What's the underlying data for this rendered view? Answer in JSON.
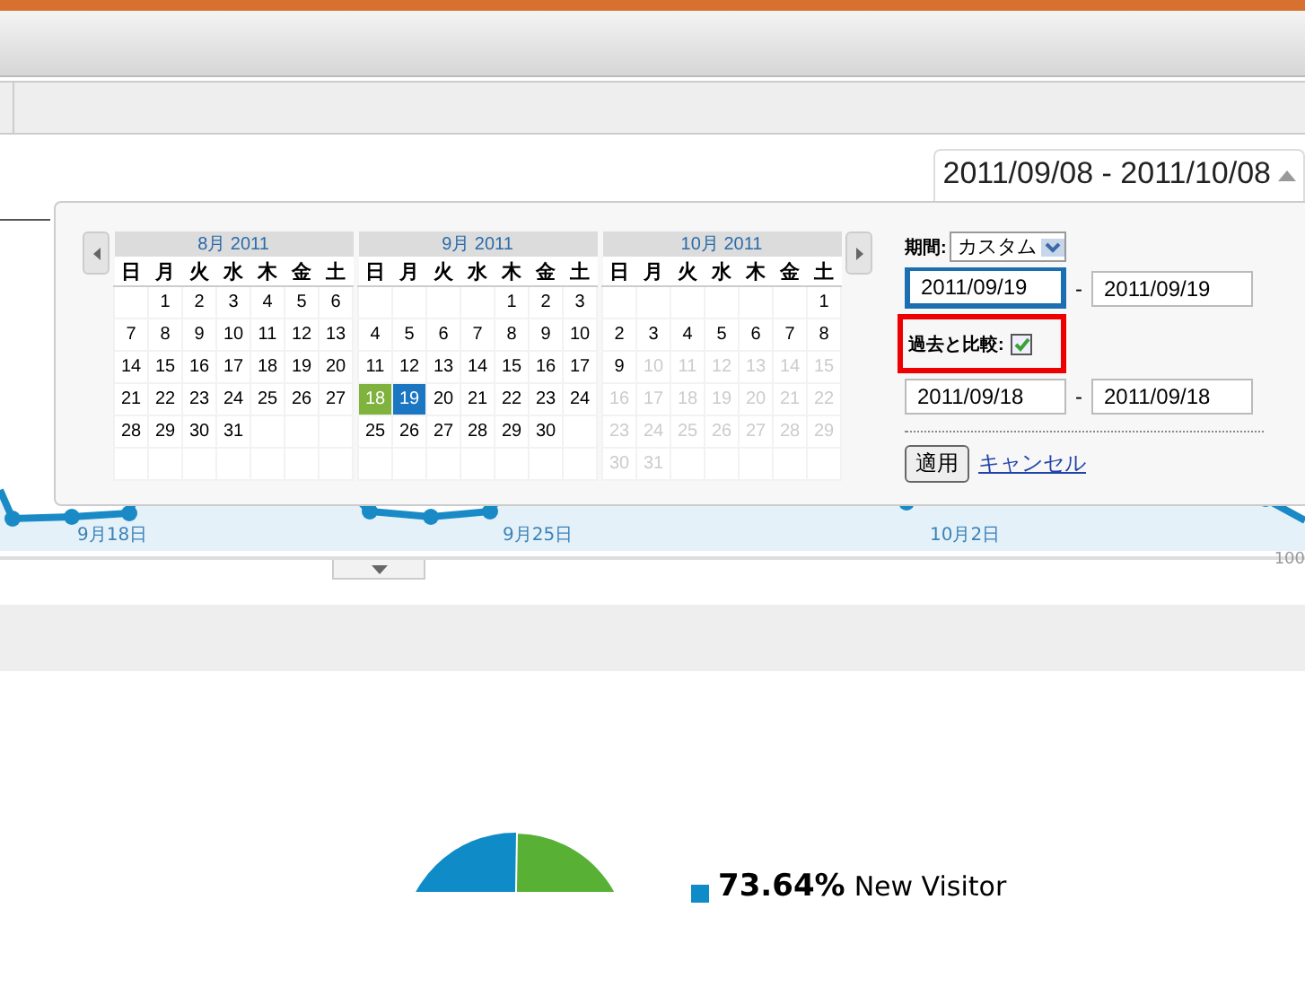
{
  "date_range": {
    "text": "2011/09/08 - 2011/10/08"
  },
  "chart": {
    "x_labels": [
      "9月18日",
      "9月25日",
      "10月2日"
    ],
    "y_label": "100"
  },
  "picker": {
    "months": [
      {
        "title": "8月 2011",
        "weekdays": [
          "日",
          "月",
          "火",
          "水",
          "木",
          "金",
          "土"
        ],
        "weeks": [
          [
            {
              "kind": "blank"
            },
            {
              "d": "1",
              "kind": "day"
            },
            {
              "d": "2",
              "kind": "day"
            },
            {
              "d": "3",
              "kind": "day"
            },
            {
              "d": "4",
              "kind": "day"
            },
            {
              "d": "5",
              "kind": "day"
            },
            {
              "d": "6",
              "kind": "day"
            }
          ],
          [
            {
              "d": "7",
              "kind": "day"
            },
            {
              "d": "8",
              "kind": "day"
            },
            {
              "d": "9",
              "kind": "day"
            },
            {
              "d": "10",
              "kind": "day"
            },
            {
              "d": "11",
              "kind": "day"
            },
            {
              "d": "12",
              "kind": "day"
            },
            {
              "d": "13",
              "kind": "day"
            }
          ],
          [
            {
              "d": "14",
              "kind": "day"
            },
            {
              "d": "15",
              "kind": "day"
            },
            {
              "d": "16",
              "kind": "day"
            },
            {
              "d": "17",
              "kind": "day"
            },
            {
              "d": "18",
              "kind": "day"
            },
            {
              "d": "19",
              "kind": "day"
            },
            {
              "d": "20",
              "kind": "day"
            }
          ],
          [
            {
              "d": "21",
              "kind": "day"
            },
            {
              "d": "22",
              "kind": "day"
            },
            {
              "d": "23",
              "kind": "day"
            },
            {
              "d": "24",
              "kind": "day"
            },
            {
              "d": "25",
              "kind": "day"
            },
            {
              "d": "26",
              "kind": "day"
            },
            {
              "d": "27",
              "kind": "day"
            }
          ],
          [
            {
              "d": "28",
              "kind": "day"
            },
            {
              "d": "29",
              "kind": "day"
            },
            {
              "d": "30",
              "kind": "day"
            },
            {
              "d": "31",
              "kind": "day"
            },
            {
              "kind": "blank"
            },
            {
              "kind": "blank"
            },
            {
              "kind": "blank"
            }
          ]
        ]
      },
      {
        "title": "9月 2011",
        "weekdays": [
          "日",
          "月",
          "火",
          "水",
          "木",
          "金",
          "土"
        ],
        "weeks": [
          [
            {
              "kind": "blank"
            },
            {
              "kind": "blank"
            },
            {
              "kind": "blank"
            },
            {
              "kind": "blank"
            },
            {
              "d": "1",
              "kind": "day"
            },
            {
              "d": "2",
              "kind": "day"
            },
            {
              "d": "3",
              "kind": "day"
            }
          ],
          [
            {
              "d": "4",
              "kind": "day"
            },
            {
              "d": "5",
              "kind": "day"
            },
            {
              "d": "6",
              "kind": "day"
            },
            {
              "d": "7",
              "kind": "day"
            },
            {
              "d": "8",
              "kind": "day"
            },
            {
              "d": "9",
              "kind": "day"
            },
            {
              "d": "10",
              "kind": "day"
            }
          ],
          [
            {
              "d": "11",
              "kind": "day"
            },
            {
              "d": "12",
              "kind": "day"
            },
            {
              "d": "13",
              "kind": "day"
            },
            {
              "d": "14",
              "kind": "day"
            },
            {
              "d": "15",
              "kind": "day"
            },
            {
              "d": "16",
              "kind": "day"
            },
            {
              "d": "17",
              "kind": "day"
            }
          ],
          [
            {
              "d": "18",
              "kind": "compare"
            },
            {
              "d": "19",
              "kind": "range"
            },
            {
              "d": "20",
              "kind": "day"
            },
            {
              "d": "21",
              "kind": "day"
            },
            {
              "d": "22",
              "kind": "day"
            },
            {
              "d": "23",
              "kind": "day"
            },
            {
              "d": "24",
              "kind": "day"
            }
          ],
          [
            {
              "d": "25",
              "kind": "day"
            },
            {
              "d": "26",
              "kind": "day"
            },
            {
              "d": "27",
              "kind": "day"
            },
            {
              "d": "28",
              "kind": "day"
            },
            {
              "d": "29",
              "kind": "day"
            },
            {
              "d": "30",
              "kind": "day"
            },
            {
              "kind": "blank"
            }
          ]
        ]
      },
      {
        "title": "10月 2011",
        "weekdays": [
          "日",
          "月",
          "火",
          "水",
          "木",
          "金",
          "土"
        ],
        "weeks": [
          [
            {
              "kind": "blank"
            },
            {
              "kind": "blank"
            },
            {
              "kind": "blank"
            },
            {
              "kind": "blank"
            },
            {
              "kind": "blank"
            },
            {
              "kind": "blank"
            },
            {
              "d": "1",
              "kind": "day"
            }
          ],
          [
            {
              "d": "2",
              "kind": "day"
            },
            {
              "d": "3",
              "kind": "day"
            },
            {
              "d": "4",
              "kind": "day"
            },
            {
              "d": "5",
              "kind": "day"
            },
            {
              "d": "6",
              "kind": "day"
            },
            {
              "d": "7",
              "kind": "day"
            },
            {
              "d": "8",
              "kind": "day"
            }
          ],
          [
            {
              "d": "9",
              "kind": "day"
            },
            {
              "d": "10",
              "kind": "future"
            },
            {
              "d": "11",
              "kind": "future"
            },
            {
              "d": "12",
              "kind": "future"
            },
            {
              "d": "13",
              "kind": "future"
            },
            {
              "d": "14",
              "kind": "future"
            },
            {
              "d": "15",
              "kind": "future"
            }
          ],
          [
            {
              "d": "16",
              "kind": "future"
            },
            {
              "d": "17",
              "kind": "future"
            },
            {
              "d": "18",
              "kind": "future"
            },
            {
              "d": "19",
              "kind": "future"
            },
            {
              "d": "20",
              "kind": "future"
            },
            {
              "d": "21",
              "kind": "future"
            },
            {
              "d": "22",
              "kind": "future"
            }
          ],
          [
            {
              "d": "23",
              "kind": "future"
            },
            {
              "d": "24",
              "kind": "future"
            },
            {
              "d": "25",
              "kind": "future"
            },
            {
              "d": "26",
              "kind": "future"
            },
            {
              "d": "27",
              "kind": "future"
            },
            {
              "d": "28",
              "kind": "future"
            },
            {
              "d": "29",
              "kind": "future"
            }
          ],
          [
            {
              "d": "30",
              "kind": "future"
            },
            {
              "d": "31",
              "kind": "future"
            },
            {
              "kind": "blank"
            },
            {
              "kind": "blank"
            },
            {
              "kind": "blank"
            },
            {
              "kind": "blank"
            },
            {
              "kind": "blank"
            }
          ]
        ]
      }
    ],
    "period_label": "期間:",
    "period_select": "カスタム",
    "range_start": "2011/09/19",
    "range_end": "2011/09/19",
    "range_separator": "-",
    "compare_label": "過去と比較:",
    "compare_checked": true,
    "compare_start": "2011/09/18",
    "compare_end": "2011/09/18",
    "compare_separator": "-",
    "apply_button": "適用",
    "cancel_link": "キャンセル"
  },
  "legend": {
    "percent": "73.64%",
    "label": "New Visitor"
  }
}
